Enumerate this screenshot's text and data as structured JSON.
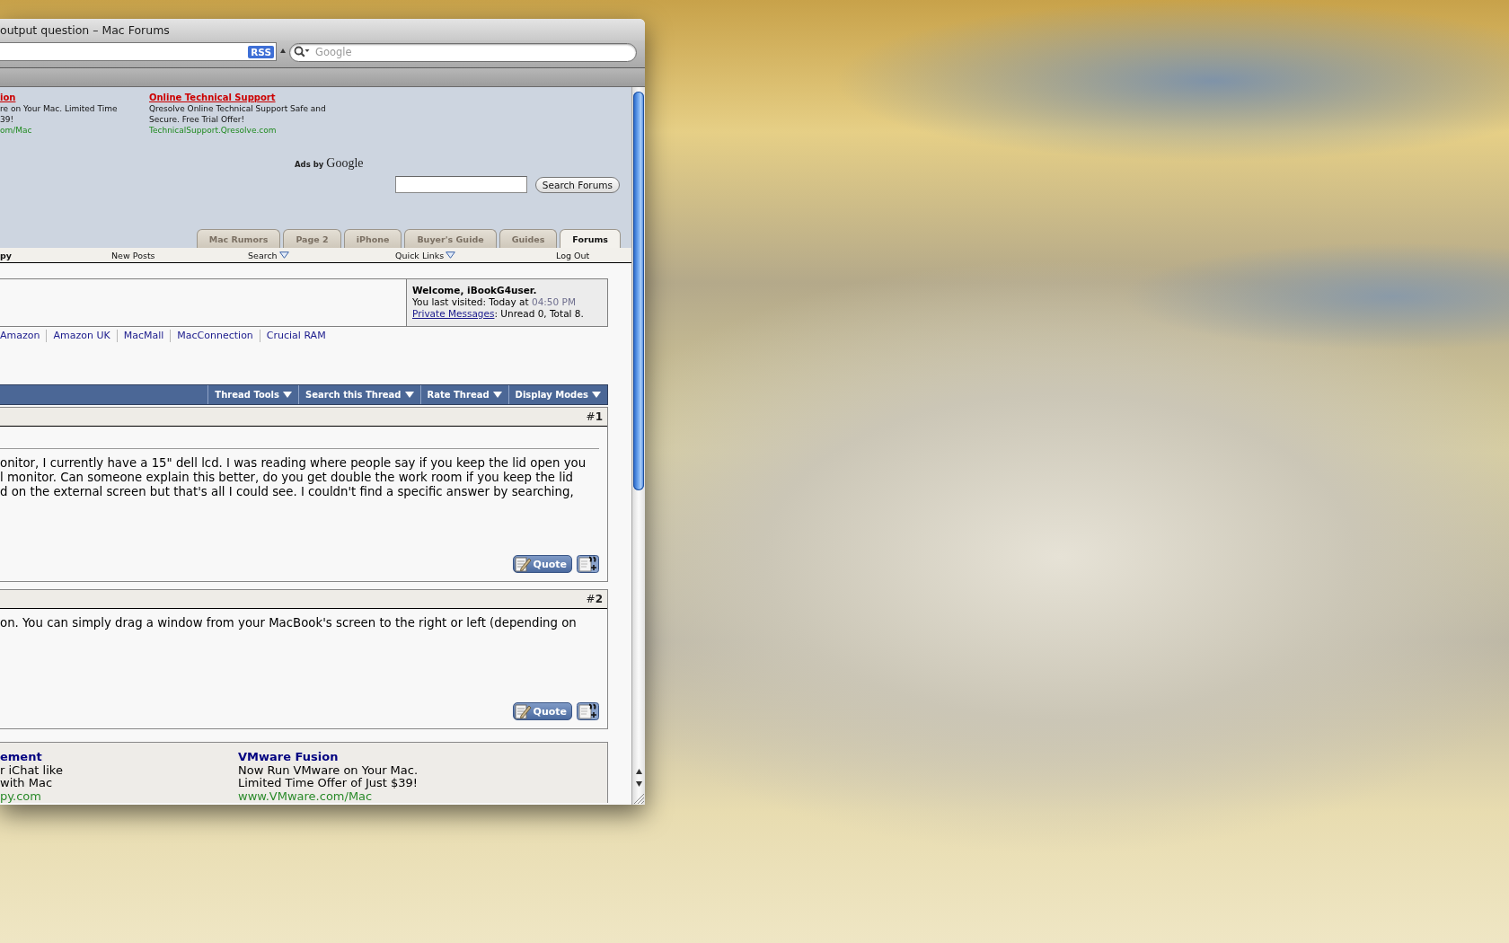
{
  "window": {
    "title": "output question – Mac Forums"
  },
  "toolbar": {
    "rss_badge": "RSS",
    "search": {
      "placeholder": "Google"
    }
  },
  "ads_top": [
    {
      "title": "ion",
      "lines": [
        "re on Your Mac. Limited Time",
        "39!"
      ],
      "url": "om/Mac"
    },
    {
      "title": "Online Technical Support",
      "lines": [
        "Qresolve Online Technical Support Safe and",
        "Secure. Free Trial Offer!"
      ],
      "url": "TechnicalSupport.Qresolve.com"
    }
  ],
  "ads_by": {
    "label": "Ads by",
    "brand": "Google"
  },
  "forum_search": {
    "button": "Search Forums"
  },
  "tabs": [
    {
      "label": "Mac Rumors",
      "selected": false
    },
    {
      "label": "Page 2",
      "selected": false
    },
    {
      "label": "iPhone",
      "selected": false
    },
    {
      "label": "Buyer's Guide",
      "selected": false
    },
    {
      "label": "Guides",
      "selected": false
    },
    {
      "label": "Forums",
      "selected": true
    }
  ],
  "navbar": [
    {
      "label": "py",
      "kind": "crumb"
    },
    {
      "label": "New Posts",
      "kind": "link"
    },
    {
      "label": "Search",
      "kind": "menu"
    },
    {
      "label": "Quick Links",
      "kind": "menu"
    },
    {
      "label": "Log Out",
      "kind": "link"
    }
  ],
  "welcome": {
    "greeting": "Welcome, iBookG4user.",
    "last_visited": "You last visited: Today at",
    "time": "04:50 PM",
    "pm_link": "Private Messages",
    "pm_status": ": Unread 0, Total 8."
  },
  "store_links": [
    "Amazon",
    "Amazon UK",
    "MacMall",
    "MacConnection",
    "Crucial RAM"
  ],
  "thread_tools": [
    "Thread Tools",
    "Search this Thread",
    "Rate Thread",
    "Display Modes"
  ],
  "posts": [
    {
      "number": "#**1**",
      "title_rule": true,
      "lines": [
        "onitor, I currently have a 15\" dell lcd. I was reading where people say if you keep the lid open you",
        "l monitor. Can someone explain this better, do you get double the work room if you keep the lid",
        "d on the external screen but that's all I could see. I couldn't find a specific answer by searching,"
      ],
      "quote_label": "Quote"
    },
    {
      "number": "#**2**",
      "title_rule": false,
      "lines": [
        "on. You can simply drag a window from your MacBook's screen to the right or left (depending on"
      ],
      "quote_label": "Quote"
    }
  ],
  "ads_bottom": [
    {
      "title": "ement",
      "lines": [
        "r iChat like",
        "with Mac"
      ],
      "url": "py.com"
    },
    {
      "title": "VMware Fusion",
      "lines": [
        "Now Run VMware on Your Mac.",
        "Limited Time Offer of Just $39!"
      ],
      "url": "www.VMware.com/Mac"
    }
  ]
}
